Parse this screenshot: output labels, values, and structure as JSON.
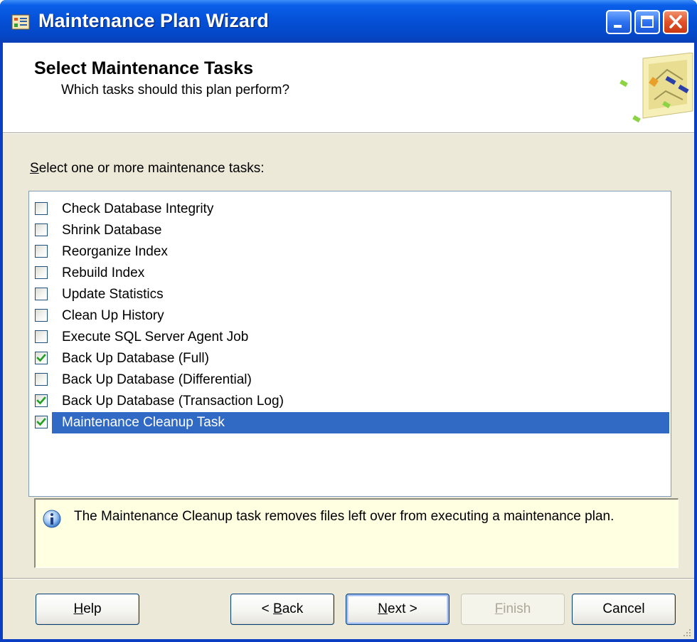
{
  "window": {
    "title": "Maintenance Plan Wizard"
  },
  "header": {
    "title": "Select Maintenance Tasks",
    "subtitle": "Which tasks should this plan perform?"
  },
  "prompt": {
    "mnemonic": "S",
    "rest": "elect one or more maintenance tasks:"
  },
  "tasks": [
    {
      "label": "Check Database Integrity",
      "checked": false
    },
    {
      "label": "Shrink Database",
      "checked": false
    },
    {
      "label": "Reorganize Index",
      "checked": false
    },
    {
      "label": "Rebuild Index",
      "checked": false
    },
    {
      "label": "Update Statistics",
      "checked": false
    },
    {
      "label": "Clean Up History",
      "checked": false
    },
    {
      "label": "Execute SQL Server Agent Job",
      "checked": false
    },
    {
      "label": "Back Up Database (Full)",
      "checked": true
    },
    {
      "label": "Back Up Database (Differential)",
      "checked": false
    },
    {
      "label": "Back Up Database (Transaction Log)",
      "checked": true
    },
    {
      "label": "Maintenance Cleanup Task",
      "checked": true,
      "selected": true
    }
  ],
  "info": {
    "text": "The Maintenance Cleanup task removes files left over from executing a maintenance plan."
  },
  "buttons": {
    "help": {
      "mnemonic": "H",
      "rest": "elp"
    },
    "back": {
      "prefix": "< ",
      "mnemonic": "B",
      "rest": "ack"
    },
    "next": {
      "mnemonic": "N",
      "rest": "ext >"
    },
    "finish": {
      "mnemonic": "F",
      "rest": "inish",
      "enabled": false
    },
    "cancel": {
      "label": "Cancel"
    }
  },
  "colors": {
    "titlebar": "#0551d8",
    "selection": "#316ac5",
    "dialog_bg": "#ece9d8",
    "info_bg": "#ffffe1",
    "check": "#21a121"
  }
}
